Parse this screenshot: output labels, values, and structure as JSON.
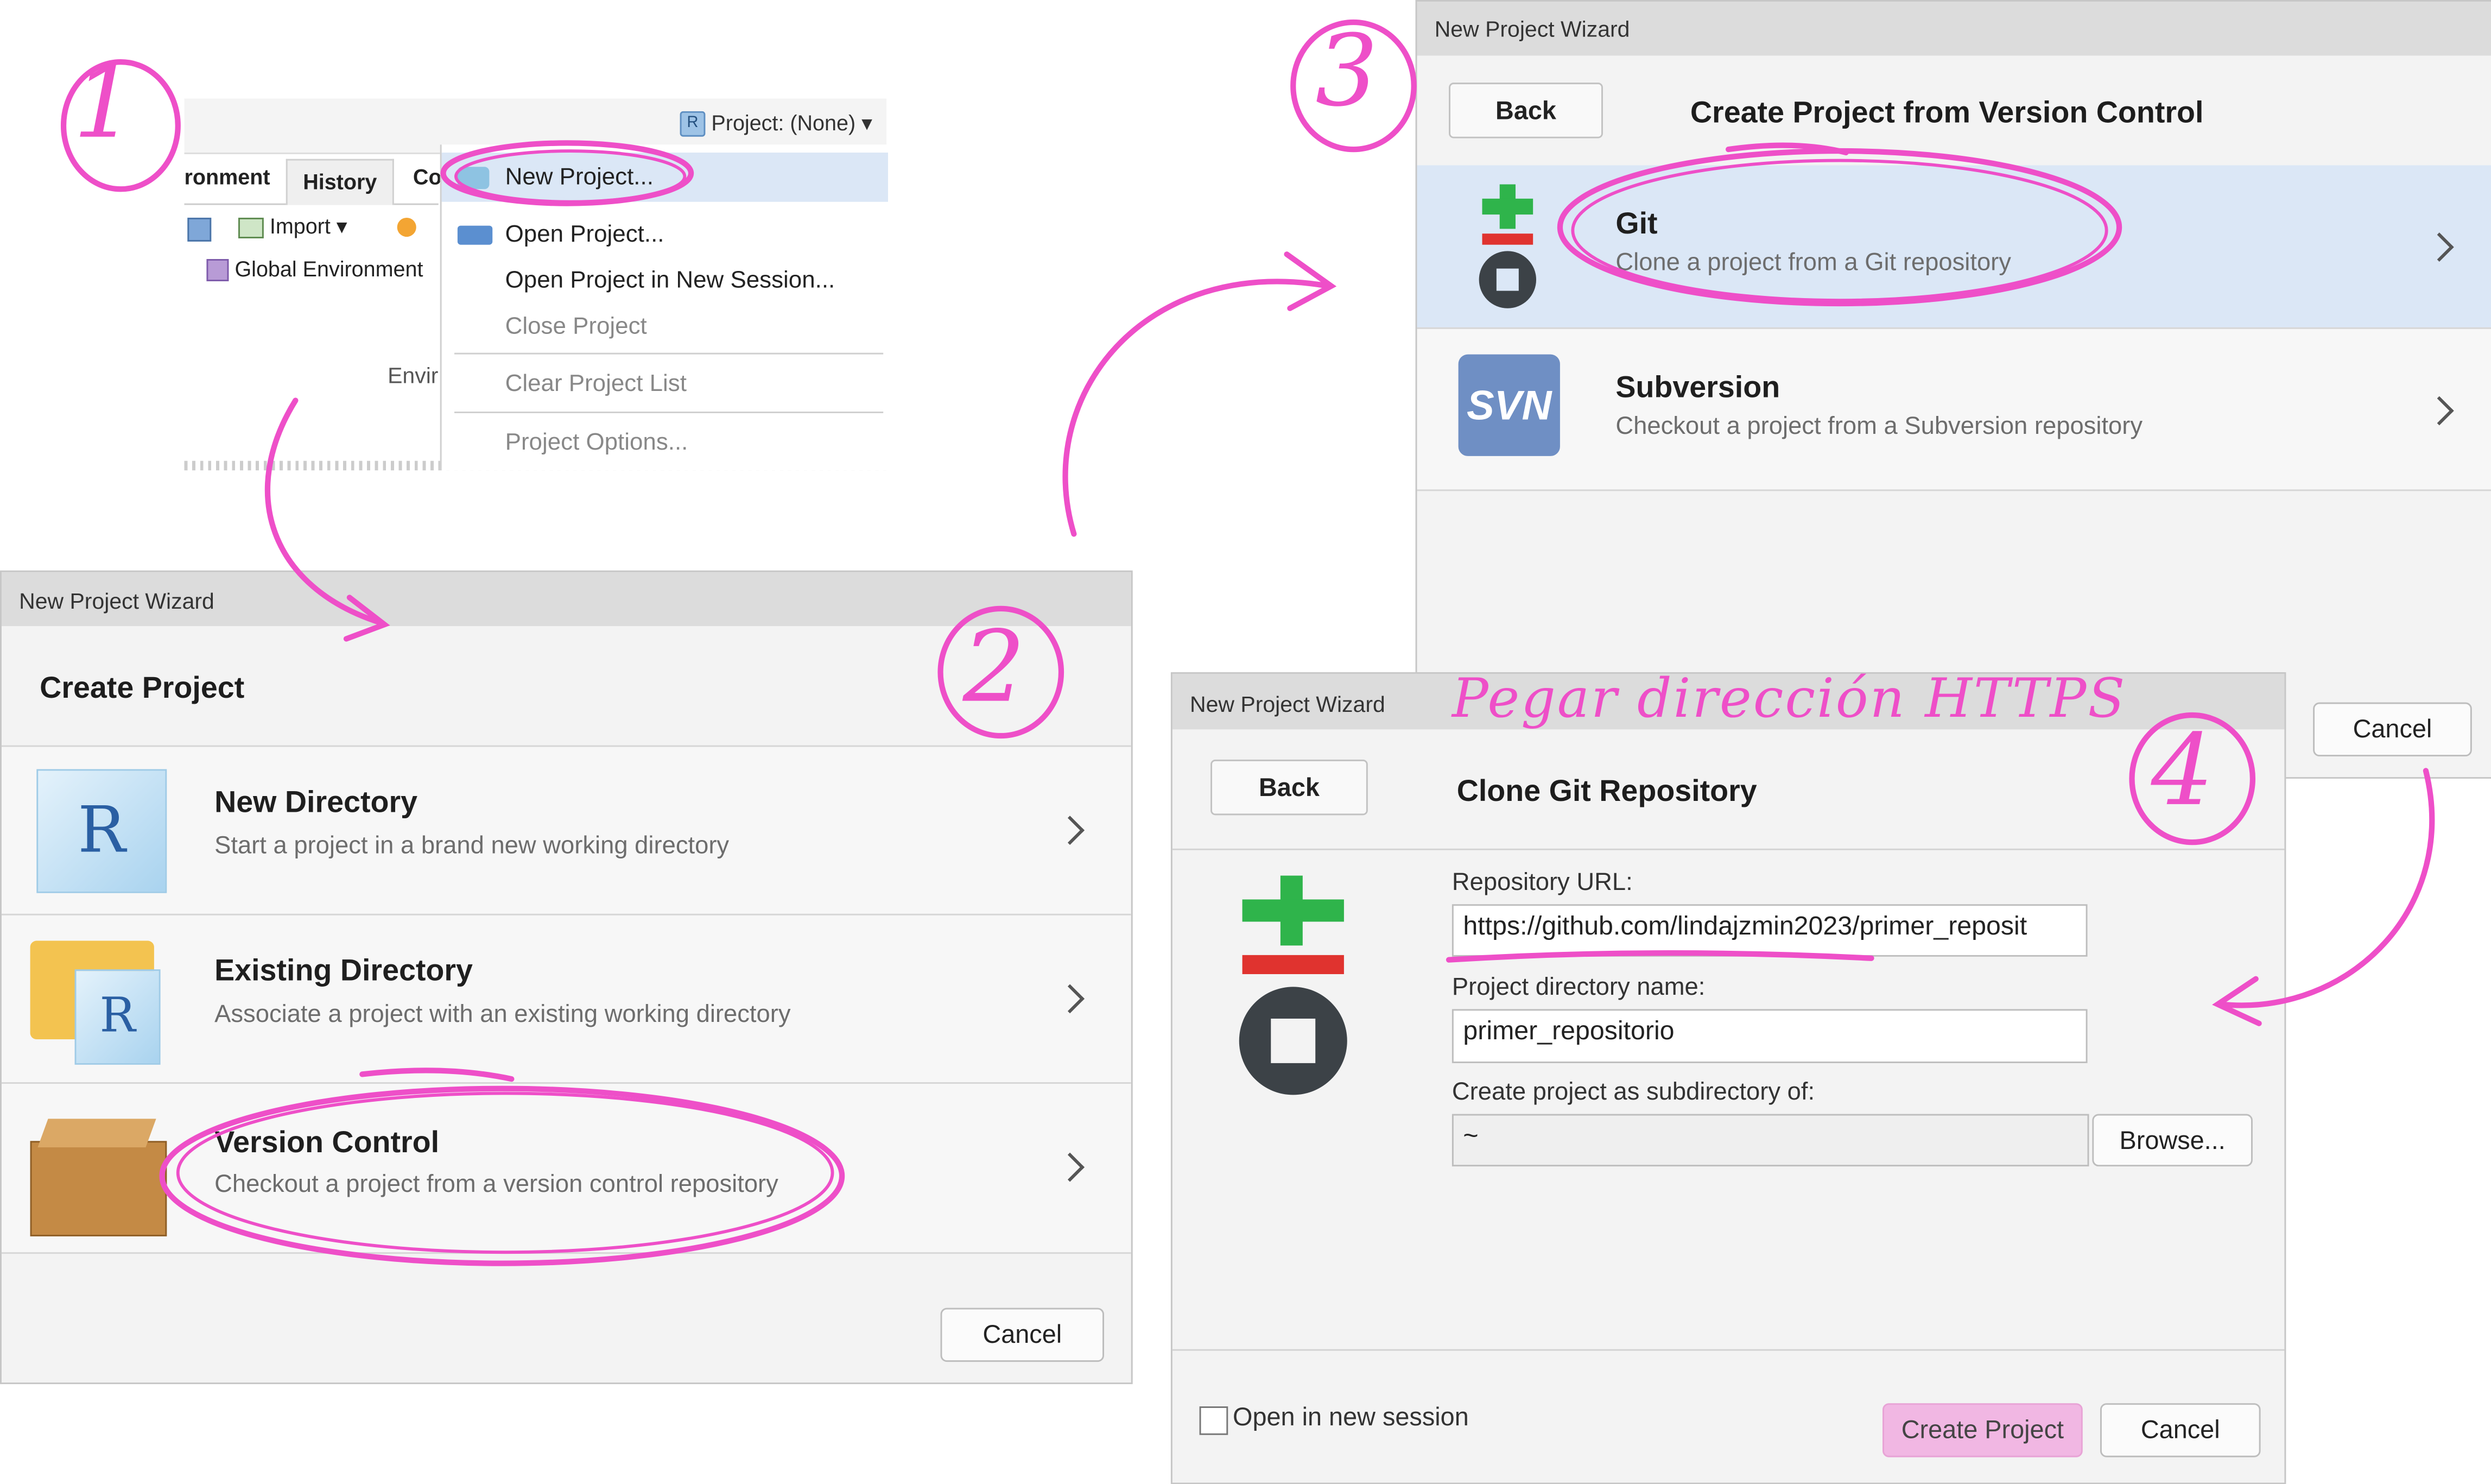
{
  "steps": {
    "one": "1",
    "two": "2",
    "three": "3",
    "four": "4"
  },
  "annotation_text": "Pegar dirección HTTPS",
  "rstudio_panel": {
    "project_button": "Project: (None)",
    "tabs": [
      "ronment",
      "History",
      "Co"
    ],
    "import_label": "Import",
    "env_label": "Global Environment",
    "env_cut": "Envir",
    "menu": {
      "new_project": "New Project...",
      "open_project": "Open Project...",
      "open_new_session": "Open Project in New Session...",
      "close_project": "Close Project",
      "clear_list": "Clear Project List",
      "project_options": "Project Options..."
    }
  },
  "wizard_create": {
    "window_title": "New Project Wizard",
    "heading": "Create Project",
    "options": [
      {
        "title": "New Directory",
        "desc": "Start a project in a brand new working directory"
      },
      {
        "title": "Existing Directory",
        "desc": "Associate a project with an existing working directory"
      },
      {
        "title": "Version Control",
        "desc": "Checkout a project from a version control repository"
      }
    ],
    "cancel": "Cancel"
  },
  "wizard_vc": {
    "window_title": "New Project Wizard",
    "back": "Back",
    "heading": "Create Project from Version Control",
    "options": [
      {
        "title": "Git",
        "desc": "Clone a project from a Git repository"
      },
      {
        "title": "Subversion",
        "desc": "Checkout a project from a Subversion repository",
        "icon_text": "SVN"
      }
    ],
    "cancel": "Cancel"
  },
  "wizard_clone": {
    "window_title": "New Project Wizard",
    "back": "Back",
    "heading": "Clone Git Repository",
    "repo_url_label": "Repository URL:",
    "repo_url_value": "https://github.com/lindajzmin2023/primer_reposit",
    "dir_name_label": "Project directory name:",
    "dir_name_value": "primer_repositorio",
    "subdir_label": "Create project as subdirectory of:",
    "subdir_value": "~",
    "browse": "Browse...",
    "open_new_session": "Open in new session",
    "create_project": "Create Project",
    "cancel": "Cancel"
  },
  "colors": {
    "annotation_pink": "#ee4fc8",
    "selection_blue": "#dbe7f6",
    "git_green": "#2fb44b",
    "git_red": "#e0332f",
    "git_dark": "#3c4247",
    "svn_blue": "#6f8fc4"
  }
}
